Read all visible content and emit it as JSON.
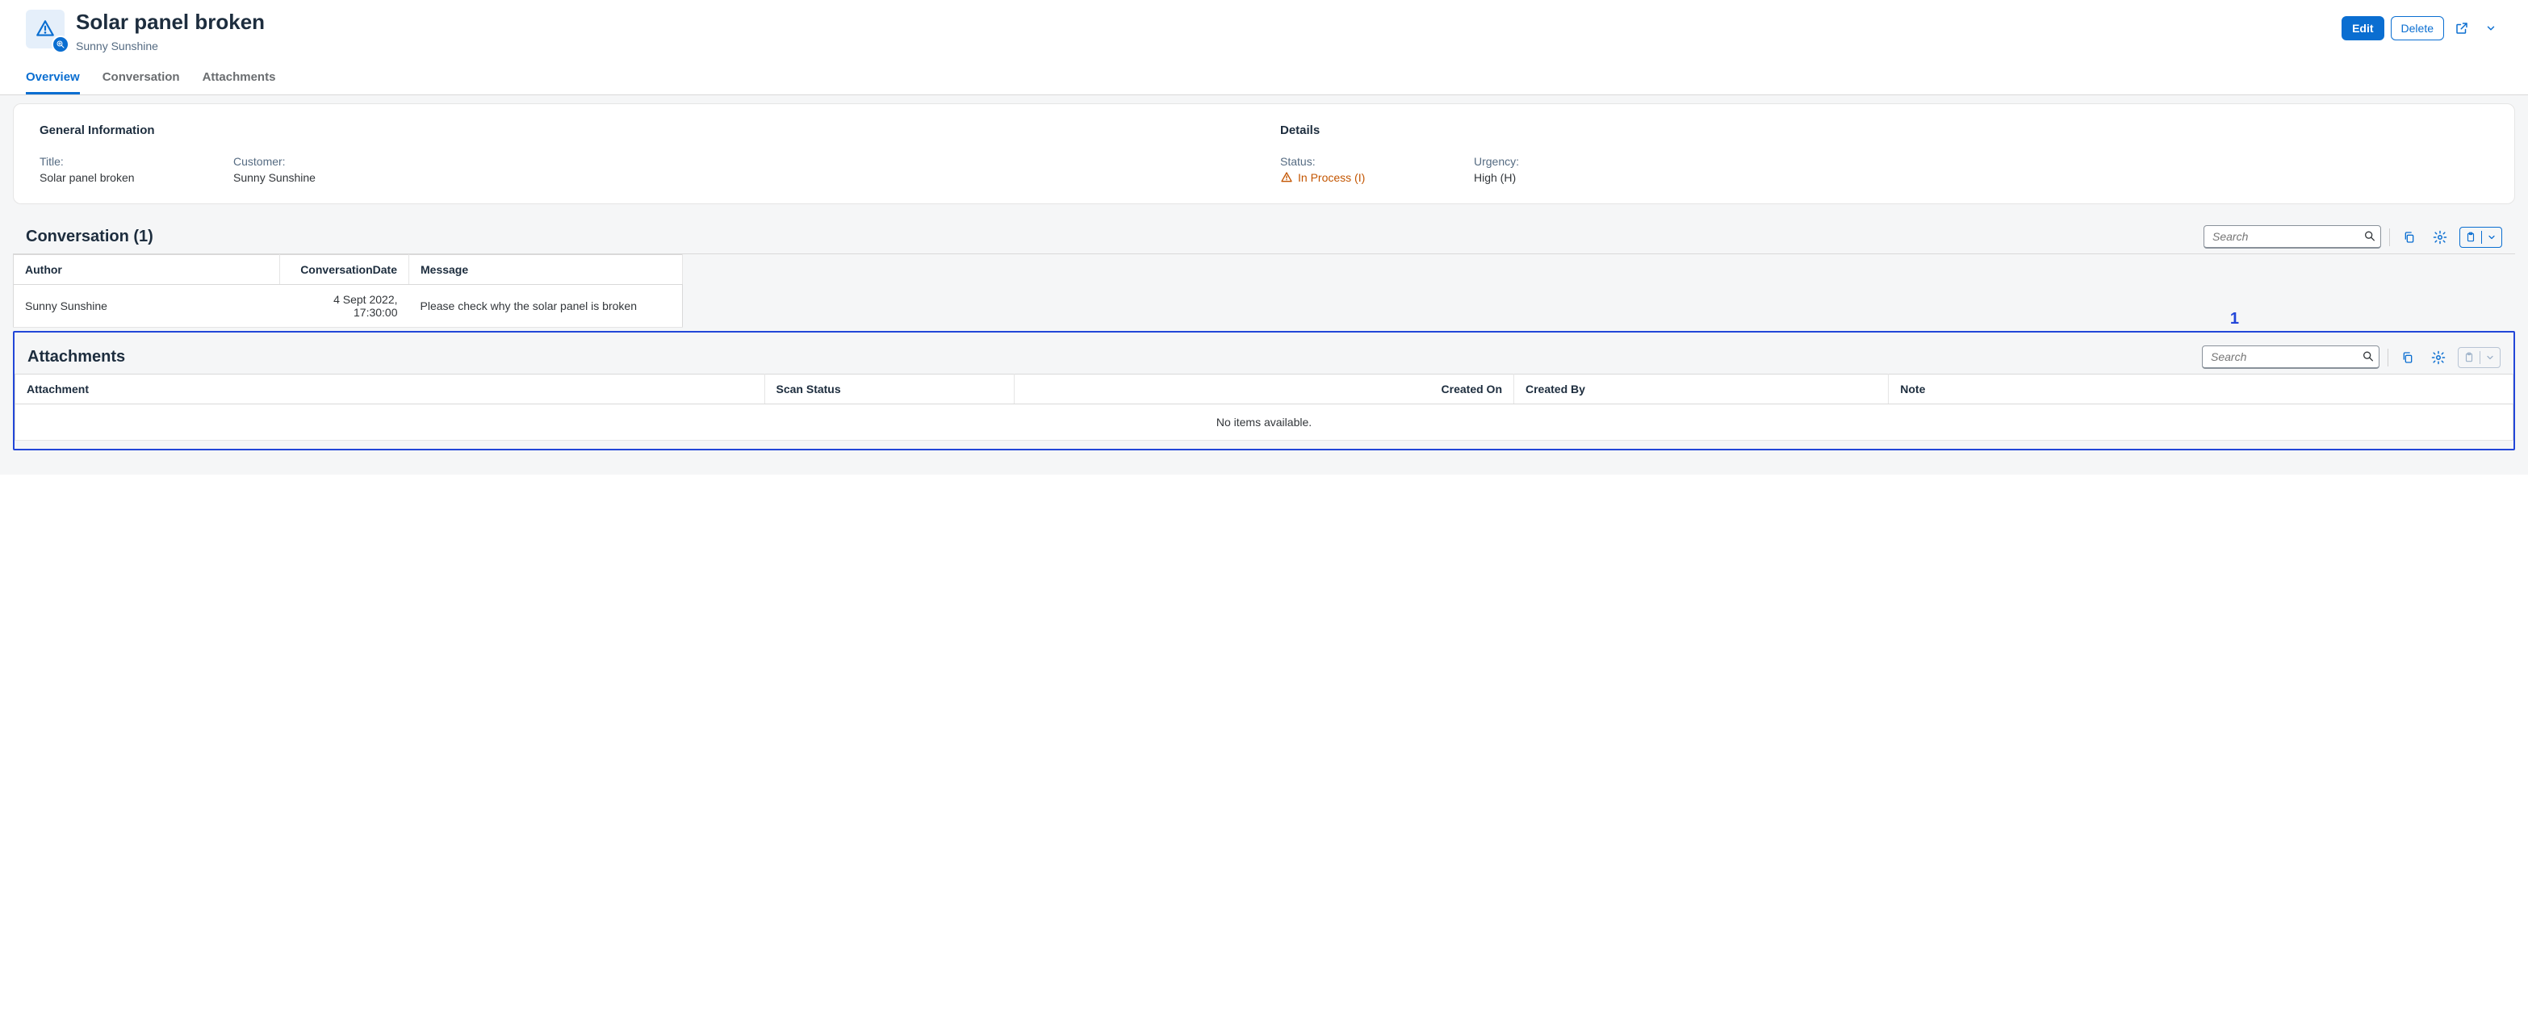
{
  "header": {
    "title": "Solar panel broken",
    "subtitle": "Sunny Sunshine",
    "edit_label": "Edit",
    "delete_label": "Delete"
  },
  "tabs": {
    "overview": "Overview",
    "conversation": "Conversation",
    "attachments": "Attachments"
  },
  "general": {
    "heading": "General Information",
    "title_label": "Title:",
    "title_value": "Solar panel broken",
    "customer_label": "Customer:",
    "customer_value": "Sunny Sunshine"
  },
  "details": {
    "heading": "Details",
    "status_label": "Status:",
    "status_value": "In Process (I)",
    "urgency_label": "Urgency:",
    "urgency_value": "High (H)"
  },
  "conversation": {
    "heading": "Conversation (1)",
    "search_placeholder": "Search",
    "columns": {
      "author": "Author",
      "date": "ConversationDate",
      "message": "Message"
    },
    "rows": [
      {
        "author": "Sunny Sunshine",
        "date": "4 Sept 2022, 17:30:00",
        "message": "Please check why the solar panel is broken"
      }
    ]
  },
  "attachments": {
    "heading": "Attachments",
    "search_placeholder": "Search",
    "columns": {
      "attachment": "Attachment",
      "scan": "Scan Status",
      "created_on": "Created On",
      "created_by": "Created By",
      "note": "Note"
    },
    "empty": "No items available."
  },
  "callout": "1"
}
